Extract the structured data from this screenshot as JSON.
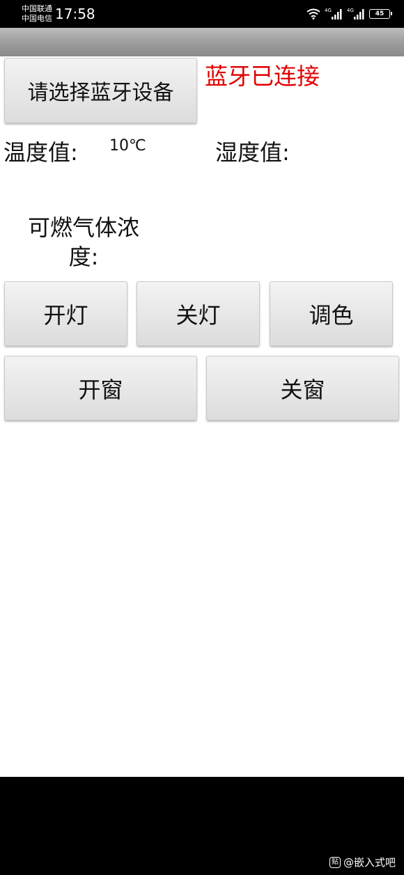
{
  "status_bar": {
    "carrier_1": "中国联通",
    "carrier_2": "中国电信",
    "time": "17:58",
    "signal_1_label": "4G",
    "signal_2_label": "4G",
    "battery_level": "45"
  },
  "main": {
    "select_device_label": "请选择蓝牙设备",
    "bluetooth_status": "蓝牙已连接",
    "temperature_label": "温度值:",
    "temperature_value": "10℃",
    "humidity_label": "湿度值:",
    "gas_label": "可燃气体浓度:"
  },
  "controls": {
    "light_on": "开灯",
    "light_off": "关灯",
    "color": "调色",
    "window_open": "开窗",
    "window_close": "关窗"
  },
  "watermark": {
    "icon_glyph": "贴",
    "text": "@嵌入式吧"
  },
  "colors": {
    "status_connected": "#e00000",
    "titlebar": "#9b9b9b",
    "button_face": "#e6e6e6",
    "system_bars": "#000000"
  }
}
